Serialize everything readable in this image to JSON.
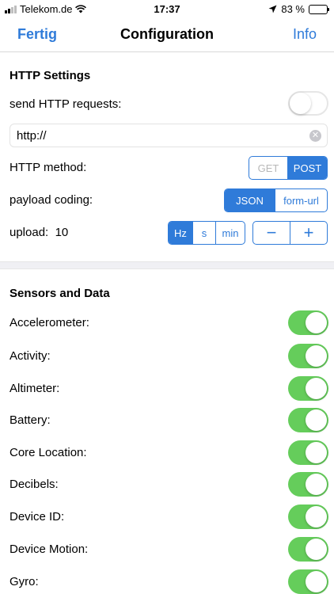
{
  "status": {
    "carrier": "Telekom.de",
    "time": "17:37",
    "battery": "83 %"
  },
  "nav": {
    "left": "Fertig",
    "title": "Configuration",
    "right": "Info"
  },
  "http": {
    "section_title": "HTTP Settings",
    "send_label": "send HTTP requests:",
    "url_value": "http://",
    "method_label": "HTTP method:",
    "methods": [
      "GET",
      "POST"
    ],
    "payload_label": "payload coding:",
    "payloads": [
      "JSON",
      "form-url"
    ],
    "upload_label": "upload:",
    "upload_value": "10",
    "units": [
      "Hz",
      "s",
      "min"
    ],
    "stepper_minus": "−",
    "stepper_plus": "+"
  },
  "sensors": {
    "section_title": "Sensors and Data",
    "items": [
      {
        "label": "Accelerometer:"
      },
      {
        "label": "Activity:"
      },
      {
        "label": "Altimeter:"
      },
      {
        "label": "Battery:"
      },
      {
        "label": "Core Location:"
      },
      {
        "label": "Decibels:"
      },
      {
        "label": "Device ID:"
      },
      {
        "label": "Device Motion:"
      },
      {
        "label": "Gyro:"
      }
    ]
  },
  "colors": {
    "accent": "#2f7bd9",
    "switch_on": "#65cd5b"
  }
}
